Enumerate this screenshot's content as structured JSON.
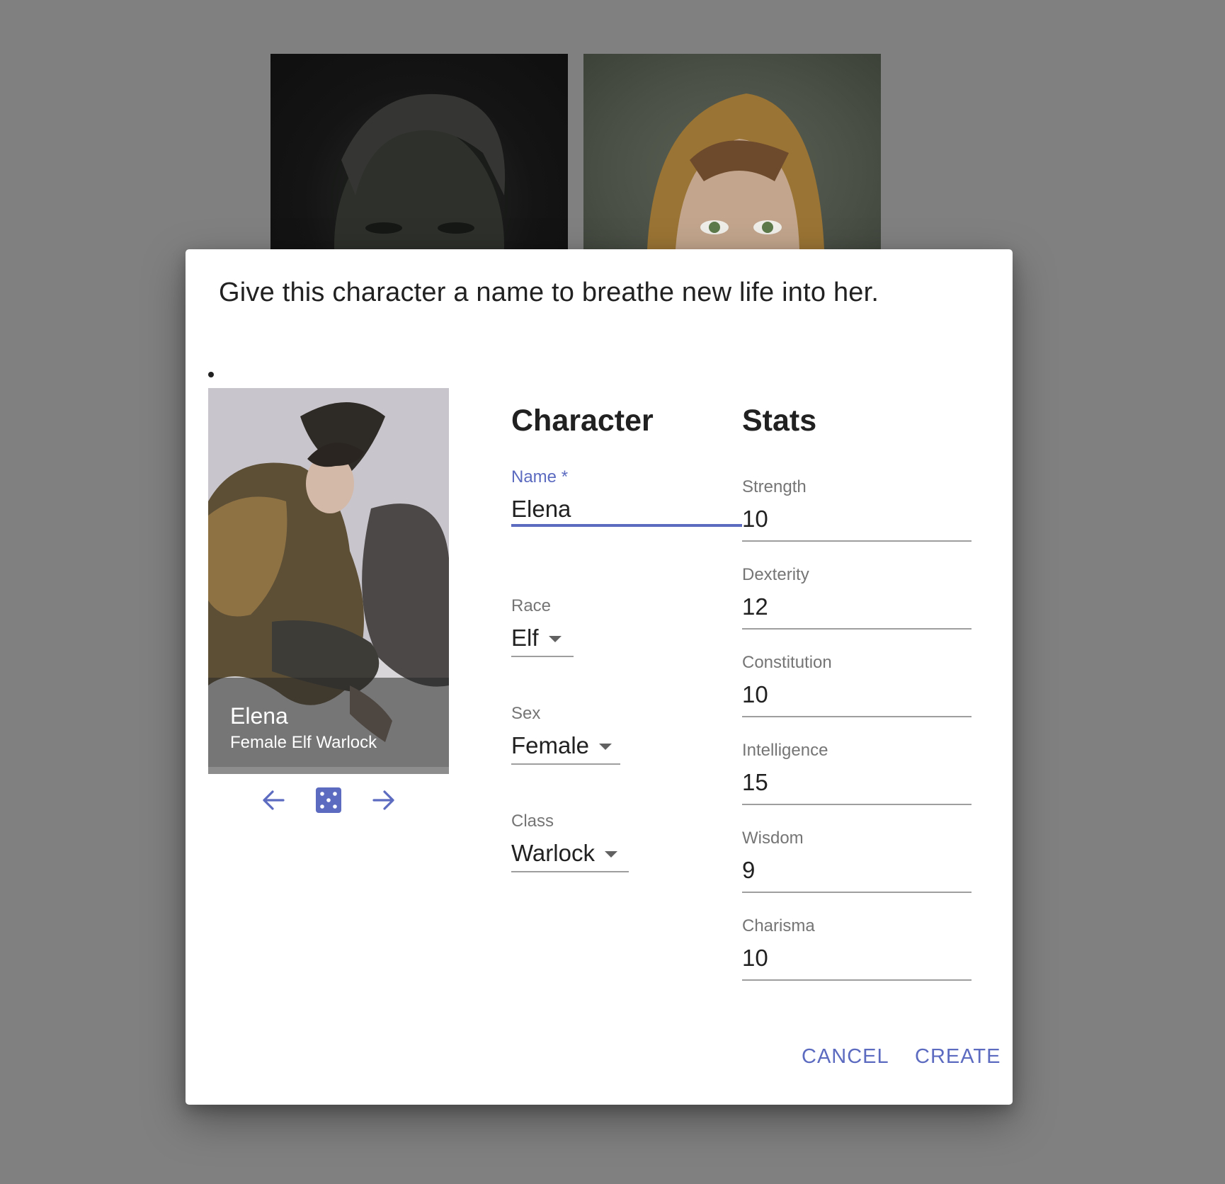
{
  "dialog": {
    "title": "Give this character a name to breathe new life into her."
  },
  "portrait": {
    "name": "Elena",
    "subtitle": "Female Elf Warlock",
    "prev_icon": "arrow-left-icon",
    "random_icon": "dice-icon",
    "next_icon": "arrow-right-icon"
  },
  "character": {
    "heading": "Character",
    "name_label": "Name *",
    "name_value": "Elena",
    "race_label": "Race",
    "race_value": "Elf",
    "sex_label": "Sex",
    "sex_value": "Female",
    "class_label": "Class",
    "class_value": "Warlock"
  },
  "stats": {
    "heading": "Stats",
    "items": [
      {
        "label": "Strength",
        "value": "10"
      },
      {
        "label": "Dexterity",
        "value": "12"
      },
      {
        "label": "Constitution",
        "value": "10"
      },
      {
        "label": "Intelligence",
        "value": "15"
      },
      {
        "label": "Wisdom",
        "value": "9"
      },
      {
        "label": "Charisma",
        "value": "10"
      }
    ]
  },
  "actions": {
    "cancel": "CANCEL",
    "create": "CREATE"
  },
  "colors": {
    "accent": "#5c6bc0",
    "backdrop": "#808080",
    "caption_overlay": "#282828"
  }
}
